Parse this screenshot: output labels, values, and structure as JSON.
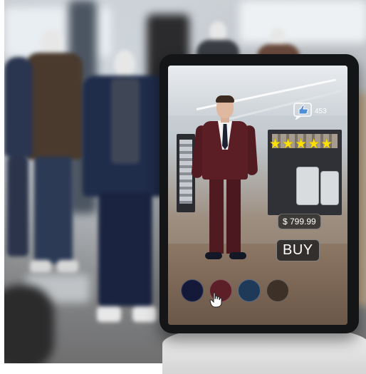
{
  "scene": {
    "description_tag": "virtual fitting mirror kiosk in clothing store"
  },
  "product": {
    "likes": "453",
    "rating_stars": 5,
    "price": "$ 799.99",
    "buy_label": "BUY"
  },
  "swatches": [
    {
      "color": "#14193a"
    },
    {
      "color": "#5c1e27"
    },
    {
      "color": "#1f3a58"
    },
    {
      "color": "#3d3127"
    }
  ],
  "icons": {
    "like": "thumbs-up-icon",
    "cursor": "pointing-hand-icon",
    "star": "star-icon"
  },
  "colors": {
    "star": "#ffe000",
    "suit": "#5a1e24",
    "kiosk": "#141516"
  }
}
